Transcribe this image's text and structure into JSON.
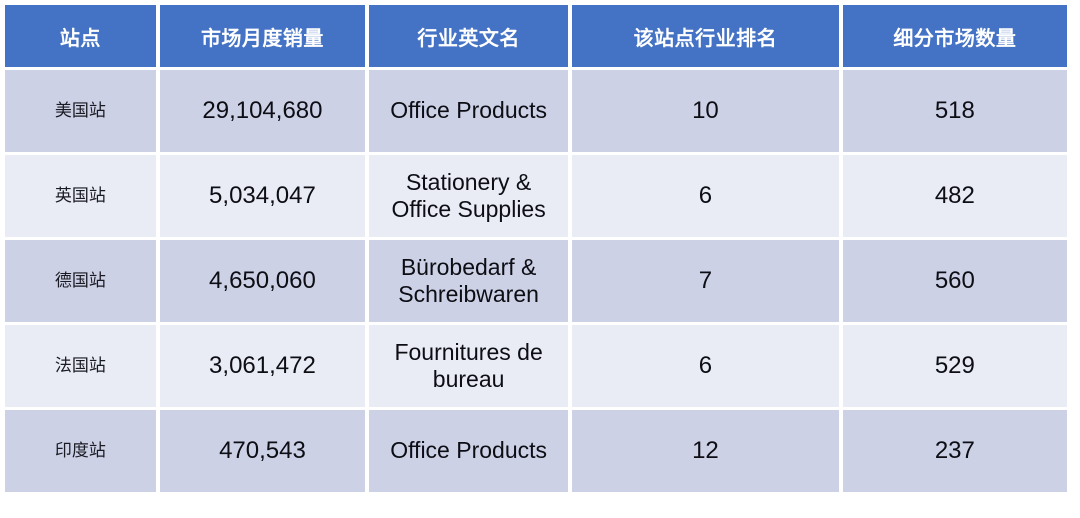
{
  "table": {
    "columns": [
      {
        "key": "site",
        "label": "站点"
      },
      {
        "key": "sales",
        "label": "市场月度销量"
      },
      {
        "key": "name_en",
        "label": "行业英文名"
      },
      {
        "key": "rank",
        "label": "该站点行业排名"
      },
      {
        "key": "markets",
        "label": "细分市场数量"
      }
    ],
    "rows": [
      {
        "site": "美国站",
        "sales": "29,104,680",
        "name_en": "Office Products",
        "rank": "10",
        "markets": "518"
      },
      {
        "site": "英国站",
        "sales": "5,034,047",
        "name_en": "Stationery & Office Supplies",
        "rank": "6",
        "markets": "482"
      },
      {
        "site": "德国站",
        "sales": "4,650,060",
        "name_en": "Bürobedarf & Schreibwaren",
        "rank": "7",
        "markets": "560"
      },
      {
        "site": "法国站",
        "sales": "3,061,472",
        "name_en": "Fournitures de bureau",
        "rank": "6",
        "markets": "529"
      },
      {
        "site": "印度站",
        "sales": "470,543",
        "name_en": "Office Products",
        "rank": "12",
        "markets": "237"
      }
    ]
  },
  "colors": {
    "header_background": "#4472C4",
    "header_text": "#FFFFFF",
    "row_band_dark": "#CCD1E6",
    "row_band_light": "#E9EBF5",
    "cell_text": "#0D0D14",
    "page_background": "#FFFFFF"
  }
}
